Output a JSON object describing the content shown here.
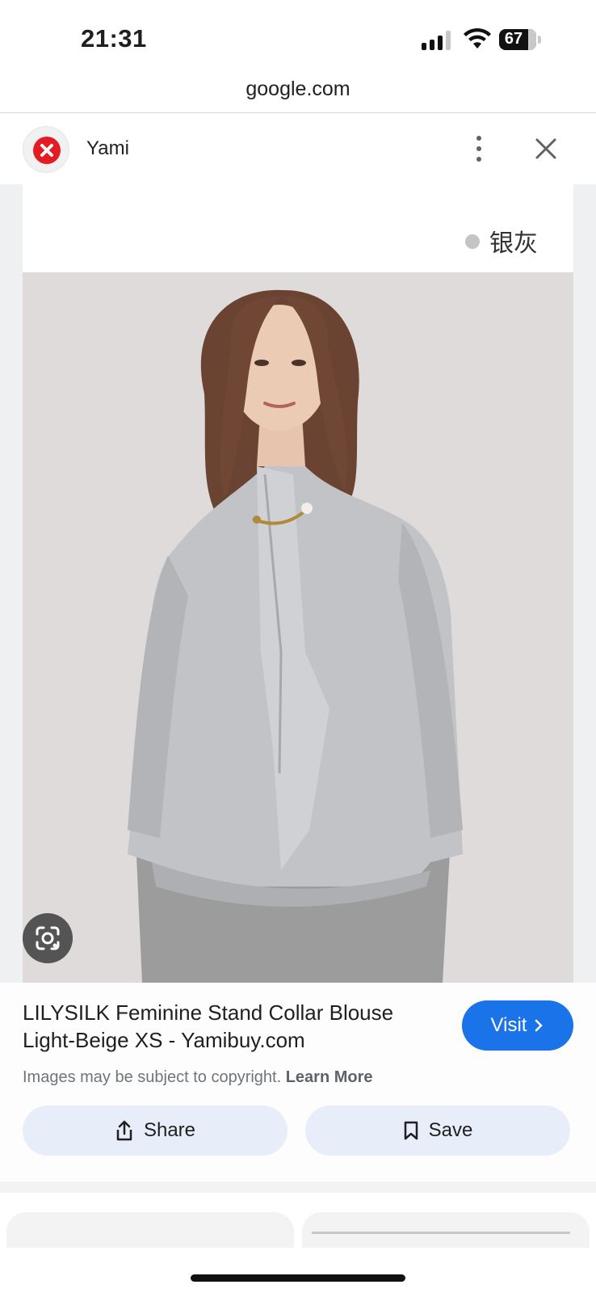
{
  "status_bar": {
    "time": "21:31",
    "battery_level": "67",
    "icons": [
      "cellular-signal-icon",
      "wifi-icon",
      "battery-icon"
    ]
  },
  "browser": {
    "url": "google.com"
  },
  "source": {
    "name": "Yami",
    "logo_color": "#e51b23",
    "icons": [
      "more-vertical-icon",
      "close-icon"
    ]
  },
  "image": {
    "color_swatch_label": "银灰",
    "swatch_color": "#c4c4c4",
    "lens_icon": "google-lens-icon"
  },
  "result": {
    "title_line1": "LILYSILK Feminine Stand Collar Blouse",
    "title_line2": "Light-Beige XS - Yamibuy.com",
    "visit_label": "Visit",
    "copyright_text": "Images may be subject to copyright.",
    "learn_more_label": "Learn More",
    "share_label": "Share",
    "save_label": "Save",
    "accent_color": "#1a73e8"
  }
}
